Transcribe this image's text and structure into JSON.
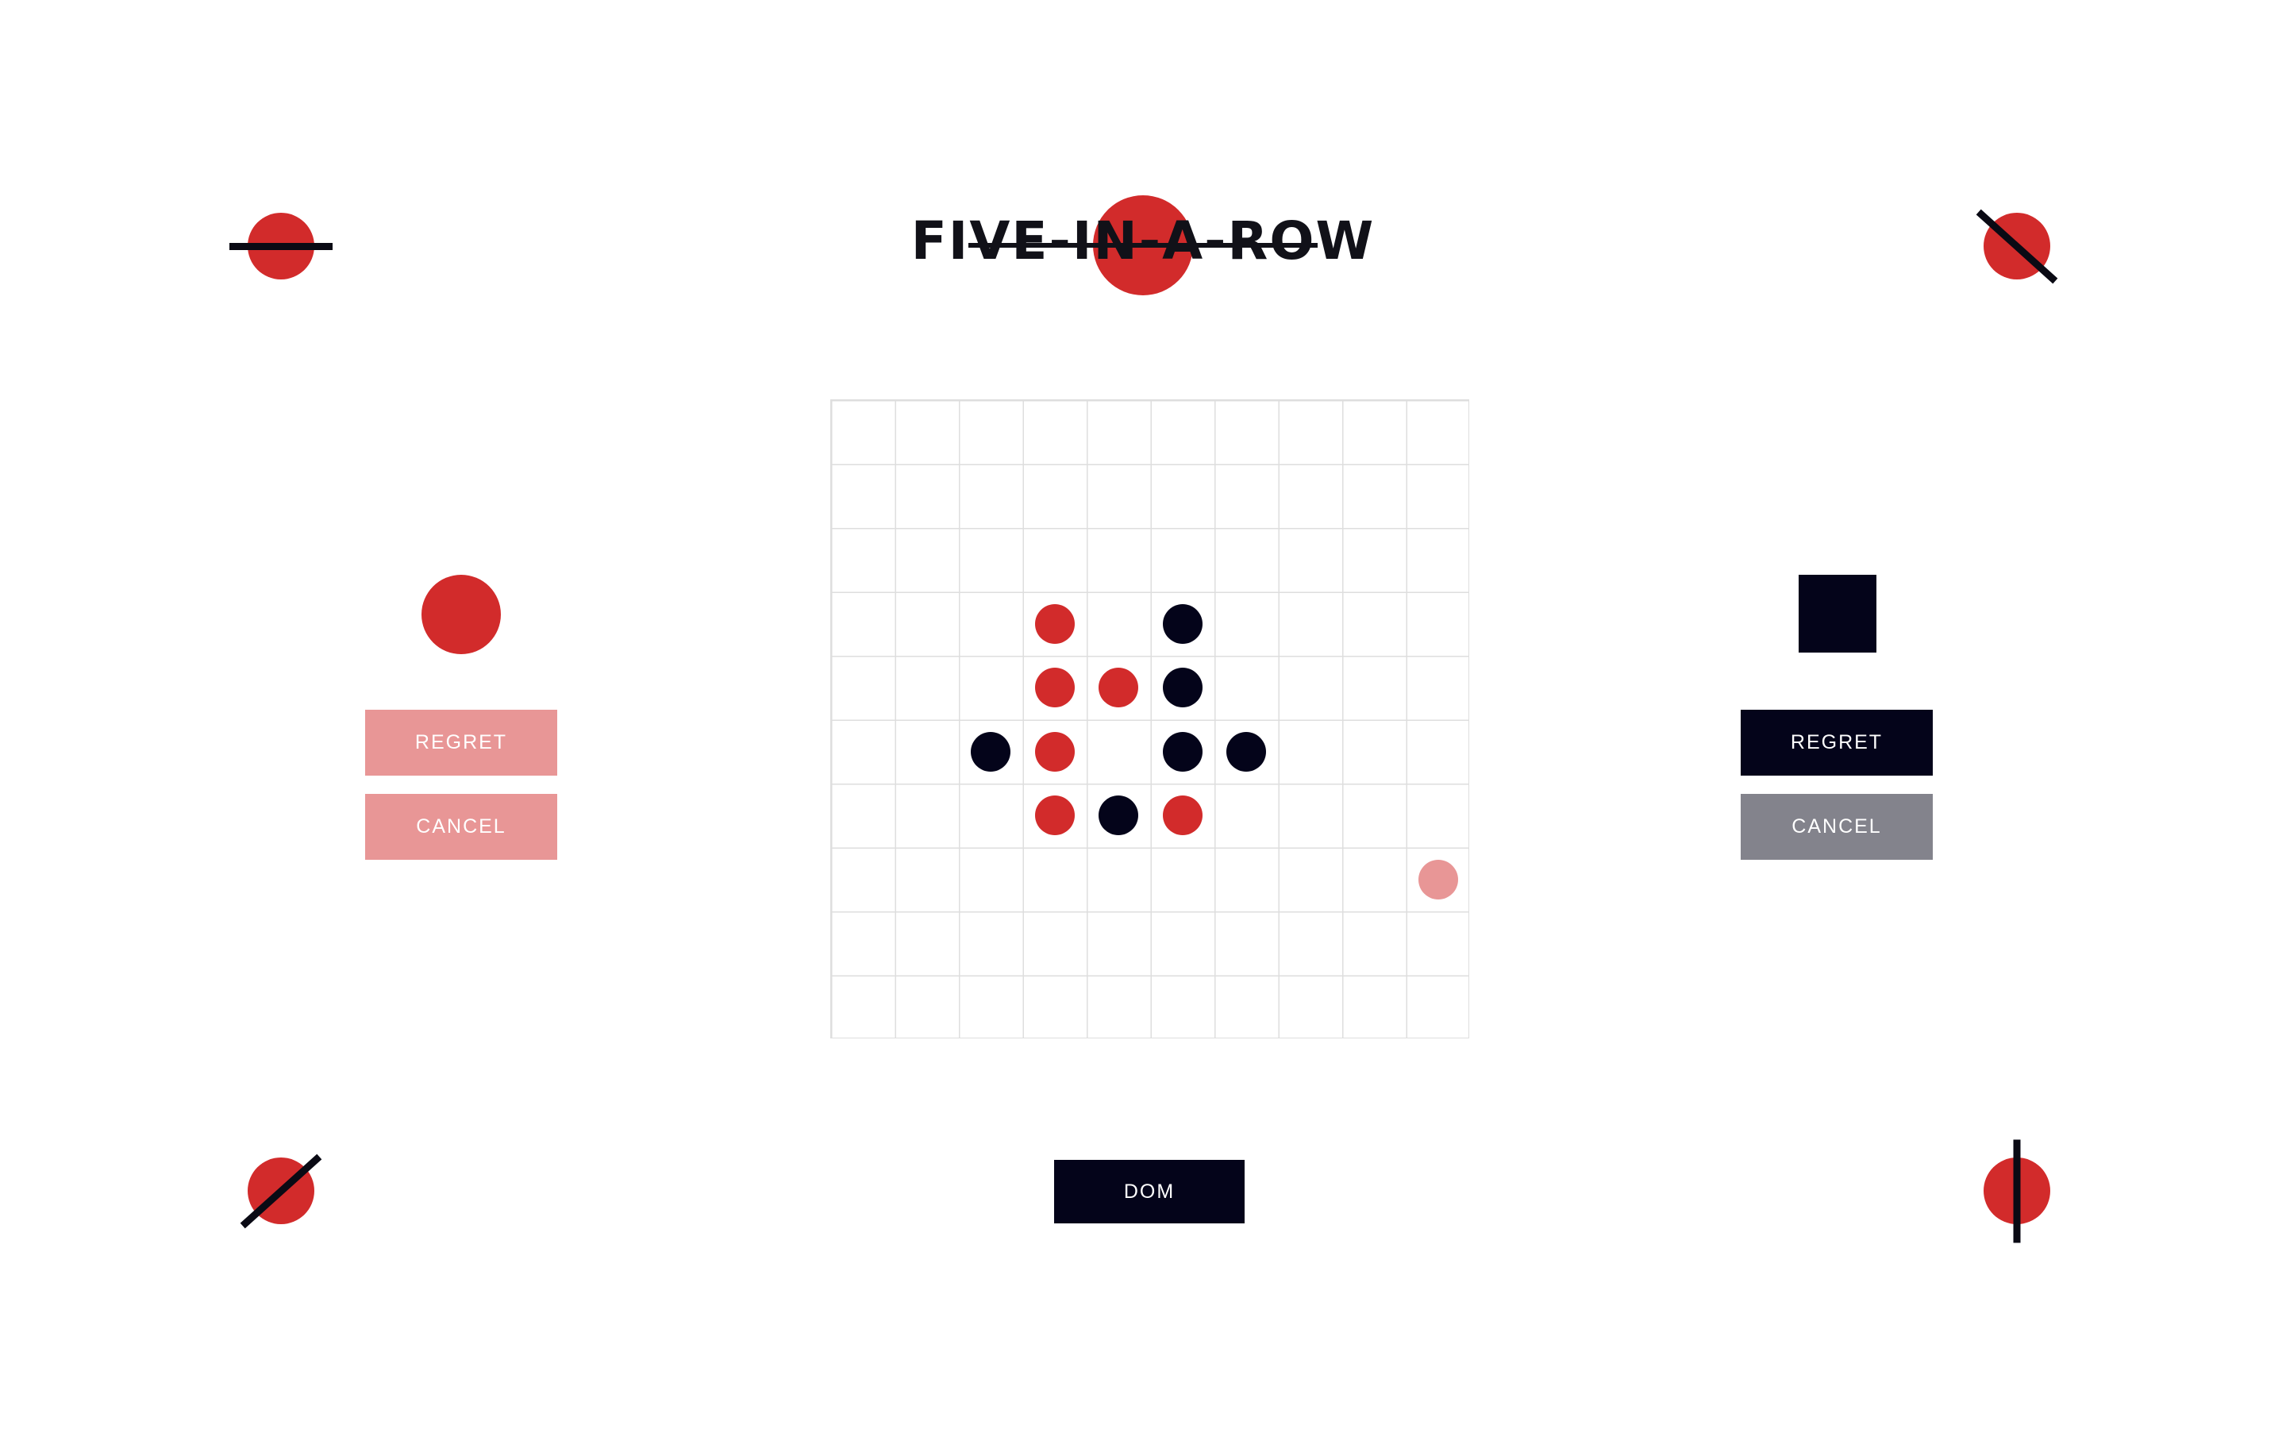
{
  "title": "FIVE-IN-A-ROW",
  "colors": {
    "red": "#d22b2b",
    "black": "#04041a",
    "red_muted": "#e89696",
    "gray": "#83838c",
    "grid": "#dedede"
  },
  "corner_icons": [
    "circle-horizontal-strike-icon",
    "circle-diagonal-strike-icon",
    "circle-diagonal-strike-icon",
    "circle-vertical-strike-icon"
  ],
  "board": {
    "size": 10,
    "stones": [
      {
        "row": 3,
        "col": 3,
        "color": "red"
      },
      {
        "row": 3,
        "col": 5,
        "color": "black"
      },
      {
        "row": 4,
        "col": 3,
        "color": "red"
      },
      {
        "row": 4,
        "col": 4,
        "color": "red"
      },
      {
        "row": 4,
        "col": 5,
        "color": "black"
      },
      {
        "row": 5,
        "col": 2,
        "color": "black"
      },
      {
        "row": 5,
        "col": 3,
        "color": "red"
      },
      {
        "row": 5,
        "col": 5,
        "color": "black"
      },
      {
        "row": 5,
        "col": 6,
        "color": "black"
      },
      {
        "row": 6,
        "col": 3,
        "color": "red"
      },
      {
        "row": 6,
        "col": 4,
        "color": "black"
      },
      {
        "row": 6,
        "col": 5,
        "color": "red"
      }
    ],
    "hover_preview": {
      "row": 7,
      "col": 9,
      "color": "red"
    }
  },
  "player_red": {
    "token_icon": "red-circle-token",
    "regret_label": "REGRET",
    "cancel_label": "CANCEL"
  },
  "player_black": {
    "token_icon": "black-square-token",
    "regret_label": "REGRET",
    "cancel_label": "CANCEL"
  },
  "mode_button_label": "DOM"
}
